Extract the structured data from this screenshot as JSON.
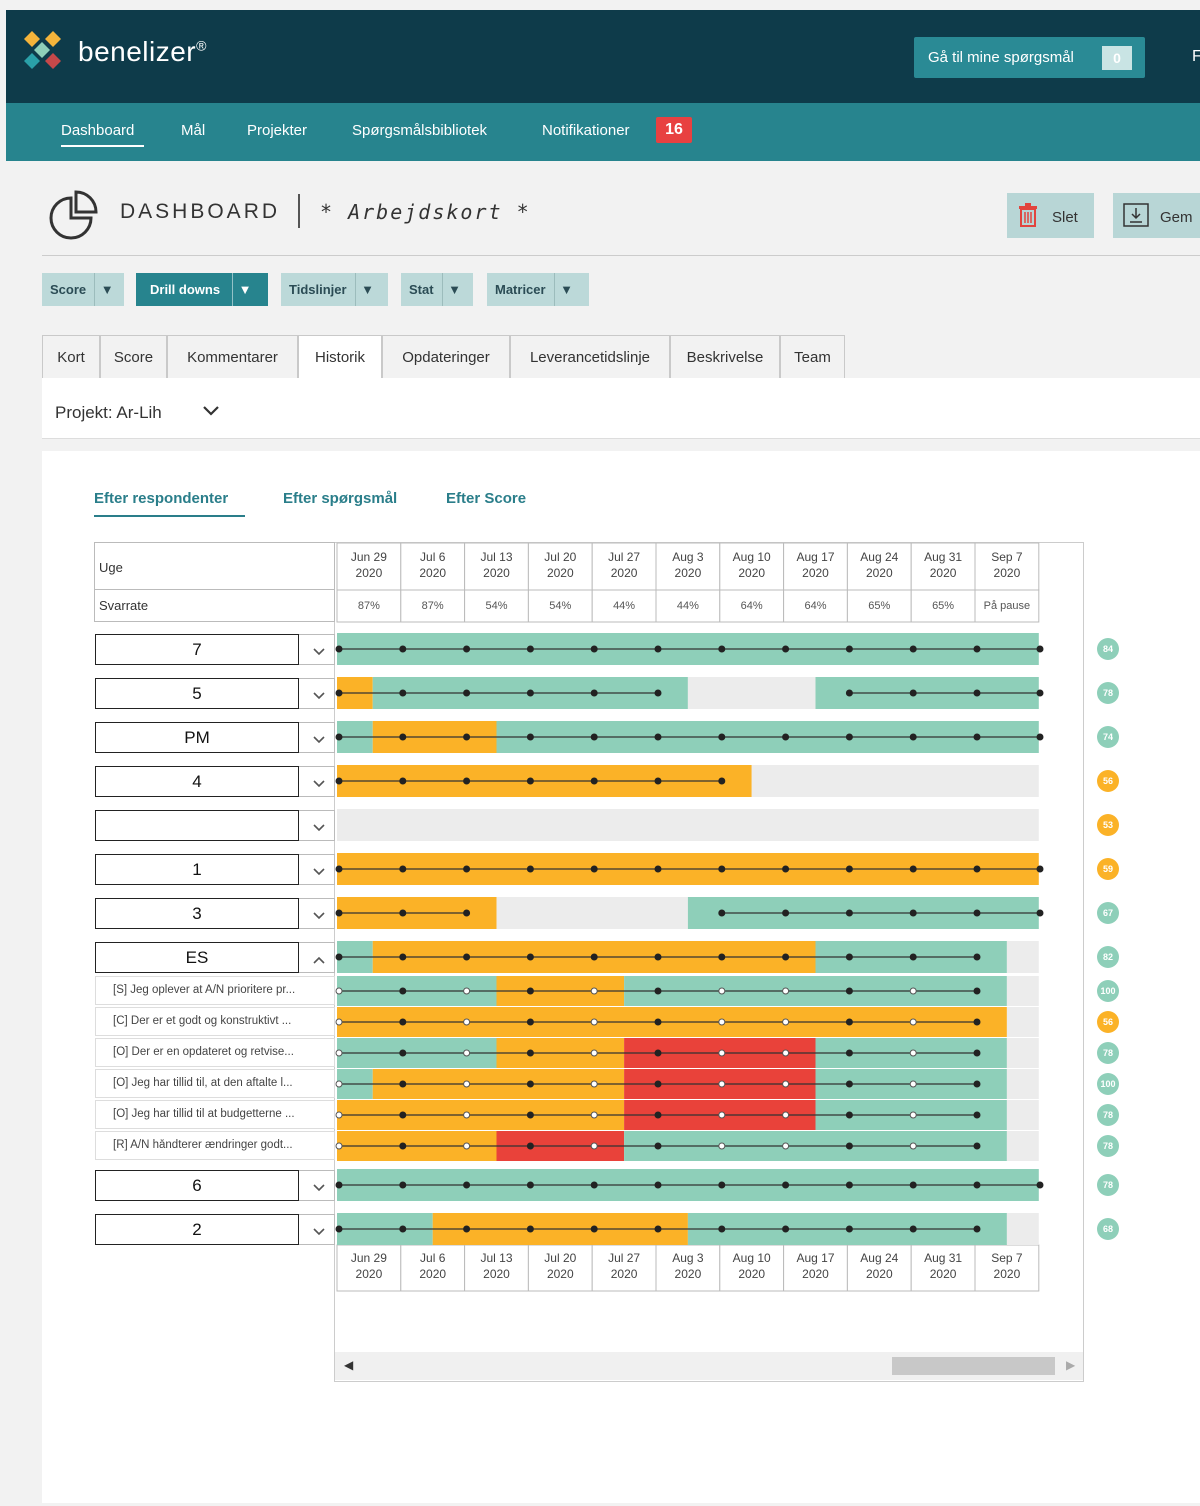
{
  "app": {
    "logo_text": "benelizer",
    "logo_reg": "®"
  },
  "top": {
    "mine_button": "Gå til mine spørgsmål",
    "mine_count": "0",
    "cut_letter": "F"
  },
  "nav": {
    "items": [
      "Dashboard",
      "Mål",
      "Projekter",
      "Spørgsmålsbibliotek",
      "Notifikationer"
    ],
    "badge": "16"
  },
  "header": {
    "title": "DASHBOARD",
    "subtitle": "* Arbejdskort *",
    "delete_label": "Slet",
    "save_label": "Gem"
  },
  "toolbar": {
    "dropdowns": [
      "Score",
      "Drill downs",
      "Tidslinjer",
      "Stat",
      "Matricer"
    ],
    "active": "Drill downs"
  },
  "tabs": {
    "items": [
      "Kort",
      "Score",
      "Kommentarer",
      "Historik",
      "Opdateringer",
      "Leverancetidslinje",
      "Beskrivelse",
      "Team"
    ],
    "active": "Historik"
  },
  "project": {
    "label": "Projekt: Ar-Lih"
  },
  "subtabs": {
    "items": [
      "Efter respondenter",
      "Efter spørgsmål",
      "Efter Score"
    ],
    "active": "Efter respondenter"
  },
  "grid": {
    "week_label": "Uge",
    "rate_label": "Svarrate",
    "weeks": [
      [
        "Jun 29",
        "2020"
      ],
      [
        "Jul 6",
        "2020"
      ],
      [
        "Jul 13",
        "2020"
      ],
      [
        "Jul 20",
        "2020"
      ],
      [
        "Jul 27",
        "2020"
      ],
      [
        "Aug 3",
        "2020"
      ],
      [
        "Aug 10",
        "2020"
      ],
      [
        "Aug 17",
        "2020"
      ],
      [
        "Aug 24",
        "2020"
      ],
      [
        "Aug 31",
        "2020"
      ],
      [
        "Sep 7",
        "2020"
      ]
    ],
    "rates": [
      "87%",
      "87%",
      "54%",
      "54%",
      "44%",
      "44%",
      "64%",
      "64%",
      "65%",
      "65%",
      "På pause"
    ],
    "colors": {
      "green": "#8ecfb9",
      "orange": "#fbb227",
      "red": "#e9423a",
      "gray": "#ececec"
    },
    "groups": [
      {
        "label": "7",
        "expanded": false,
        "score": "84",
        "score_color": "green",
        "segments": [
          [
            "green",
            0,
            11
          ]
        ],
        "points": [
          0,
          1,
          2,
          3,
          4,
          5,
          6,
          7,
          8,
          9,
          10,
          11
        ],
        "hollow": []
      },
      {
        "label": "5",
        "expanded": false,
        "score": "78",
        "score_color": "green",
        "segments": [
          [
            "orange",
            0,
            0.56
          ],
          [
            "green",
            0.56,
            5.5
          ],
          [
            "gray",
            5.5,
            7.5
          ],
          [
            "green",
            7.5,
            11
          ]
        ],
        "points": [
          0,
          1,
          2,
          3,
          4,
          5,
          8,
          9,
          10,
          11
        ],
        "hollow": [],
        "breaks": [
          5
        ]
      },
      {
        "label": "PM",
        "expanded": false,
        "score": "74",
        "score_color": "green",
        "segments": [
          [
            "green",
            0,
            0.56
          ],
          [
            "orange",
            0.56,
            2.5
          ],
          [
            "green",
            2.5,
            11
          ]
        ],
        "points": [
          0,
          1,
          2,
          3,
          4,
          5,
          6,
          7,
          8,
          9,
          10,
          11
        ],
        "hollow": []
      },
      {
        "label": "4",
        "expanded": false,
        "score": "56",
        "score_color": "orange",
        "segments": [
          [
            "orange",
            0,
            6.5
          ],
          [
            "gray",
            6.5,
            11
          ]
        ],
        "points": [
          0,
          1,
          2,
          3,
          4,
          5,
          6
        ],
        "hollow": []
      },
      {
        "label": "",
        "expanded": false,
        "score": "53",
        "score_color": "orange",
        "segments": [
          [
            "gray",
            0,
            11
          ]
        ],
        "points": [],
        "hollow": []
      },
      {
        "label": "1",
        "expanded": false,
        "score": "59",
        "score_color": "orange",
        "segments": [
          [
            "orange",
            0,
            11
          ]
        ],
        "points": [
          0,
          1,
          2,
          3,
          4,
          5,
          6,
          7,
          8,
          9,
          10,
          11
        ],
        "hollow": []
      },
      {
        "label": "3",
        "expanded": false,
        "score": "67",
        "score_color": "green",
        "segments": [
          [
            "orange",
            0,
            2.5
          ],
          [
            "gray",
            2.5,
            5.5
          ],
          [
            "green",
            5.5,
            11
          ]
        ],
        "points": [
          0,
          1,
          2,
          6,
          7,
          8,
          9,
          10,
          11
        ],
        "hollow": [],
        "breaks": [
          2
        ]
      },
      {
        "label": "ES",
        "expanded": true,
        "score": "82",
        "score_color": "green",
        "segments": [
          [
            "green",
            0,
            0.56
          ],
          [
            "orange",
            0.56,
            7.5
          ],
          [
            "green",
            7.5,
            10.5
          ],
          [
            "gray",
            10.5,
            11
          ]
        ],
        "points": [
          0,
          1,
          2,
          3,
          4,
          5,
          6,
          7,
          8,
          9,
          10
        ],
        "hollow": [],
        "questions": [
          {
            "label": "[S] Jeg oplever at A/N prioritere pr...",
            "score": "100",
            "score_color": "green",
            "segments": [
              [
                "green",
                0,
                2.5
              ],
              [
                "orange",
                2.5,
                4.5
              ],
              [
                "green",
                4.5,
                10.5
              ],
              [
                "gray",
                10.5,
                11
              ]
            ],
            "points": [
              0,
              1,
              2,
              3,
              4,
              5,
              6,
              7,
              8,
              9,
              10
            ],
            "hollow": [
              0,
              2,
              4,
              6,
              7,
              9
            ]
          },
          {
            "label": "[C] Der er et godt og konstruktivt ...",
            "score": "56",
            "score_color": "orange",
            "segments": [
              [
                "orange",
                0,
                10.5
              ],
              [
                "gray",
                10.5,
                11
              ]
            ],
            "points": [
              0,
              1,
              2,
              3,
              4,
              5,
              6,
              7,
              8,
              9,
              10
            ],
            "hollow": [
              0,
              2,
              4,
              6,
              7,
              9
            ]
          },
          {
            "label": "[O] Der er en opdateret og retvise...",
            "score": "78",
            "score_color": "green",
            "segments": [
              [
                "green",
                0,
                2.5
              ],
              [
                "orange",
                2.5,
                4.5
              ],
              [
                "red",
                4.5,
                7.5
              ],
              [
                "green",
                7.5,
                10.5
              ],
              [
                "gray",
                10.5,
                11
              ]
            ],
            "points": [
              0,
              1,
              2,
              3,
              4,
              5,
              6,
              7,
              8,
              9,
              10
            ],
            "hollow": [
              0,
              2,
              4,
              6,
              7,
              9
            ]
          },
          {
            "label": "[O] Jeg har tillid til, at den aftalte l...",
            "score": "100",
            "score_color": "green",
            "segments": [
              [
                "green",
                0,
                0.56
              ],
              [
                "orange",
                0.56,
                4.5
              ],
              [
                "red",
                4.5,
                7.5
              ],
              [
                "green",
                7.5,
                10.5
              ],
              [
                "gray",
                10.5,
                11
              ]
            ],
            "points": [
              0,
              1,
              2,
              3,
              4,
              5,
              6,
              7,
              8,
              9,
              10
            ],
            "hollow": [
              0,
              2,
              4,
              6,
              7,
              9
            ]
          },
          {
            "label": "[O] Jeg har tillid til at budgetterne ...",
            "score": "78",
            "score_color": "green",
            "segments": [
              [
                "orange",
                0,
                4.5
              ],
              [
                "red",
                4.5,
                7.5
              ],
              [
                "green",
                7.5,
                10.5
              ],
              [
                "gray",
                10.5,
                11
              ]
            ],
            "points": [
              0,
              1,
              2,
              3,
              4,
              5,
              6,
              7,
              8,
              9,
              10
            ],
            "hollow": [
              0,
              2,
              4,
              6,
              7,
              9
            ]
          },
          {
            "label": "[R] A/N håndterer ændringer godt...",
            "score": "78",
            "score_color": "green",
            "segments": [
              [
                "orange",
                0,
                2.5
              ],
              [
                "red",
                2.5,
                4.5
              ],
              [
                "green",
                4.5,
                10.5
              ],
              [
                "gray",
                10.5,
                11
              ]
            ],
            "points": [
              0,
              1,
              2,
              3,
              4,
              5,
              6,
              7,
              8,
              9,
              10
            ],
            "hollow": [
              0,
              2,
              4,
              6,
              7,
              9
            ]
          }
        ]
      },
      {
        "label": "6",
        "expanded": false,
        "score": "78",
        "score_color": "green",
        "segments": [
          [
            "green",
            0,
            11
          ]
        ],
        "points": [
          0,
          1,
          2,
          3,
          4,
          5,
          6,
          7,
          8,
          9,
          10,
          11
        ],
        "hollow": []
      },
      {
        "label": "2",
        "expanded": false,
        "score": "68",
        "score_color": "green",
        "segments": [
          [
            "green",
            0,
            1.5
          ],
          [
            "orange",
            1.5,
            5.5
          ],
          [
            "green",
            5.5,
            10.5
          ],
          [
            "gray",
            10.5,
            11
          ]
        ],
        "points": [
          0,
          1,
          2,
          3,
          4,
          5,
          6,
          7,
          8,
          9,
          10
        ],
        "hollow": []
      }
    ]
  }
}
